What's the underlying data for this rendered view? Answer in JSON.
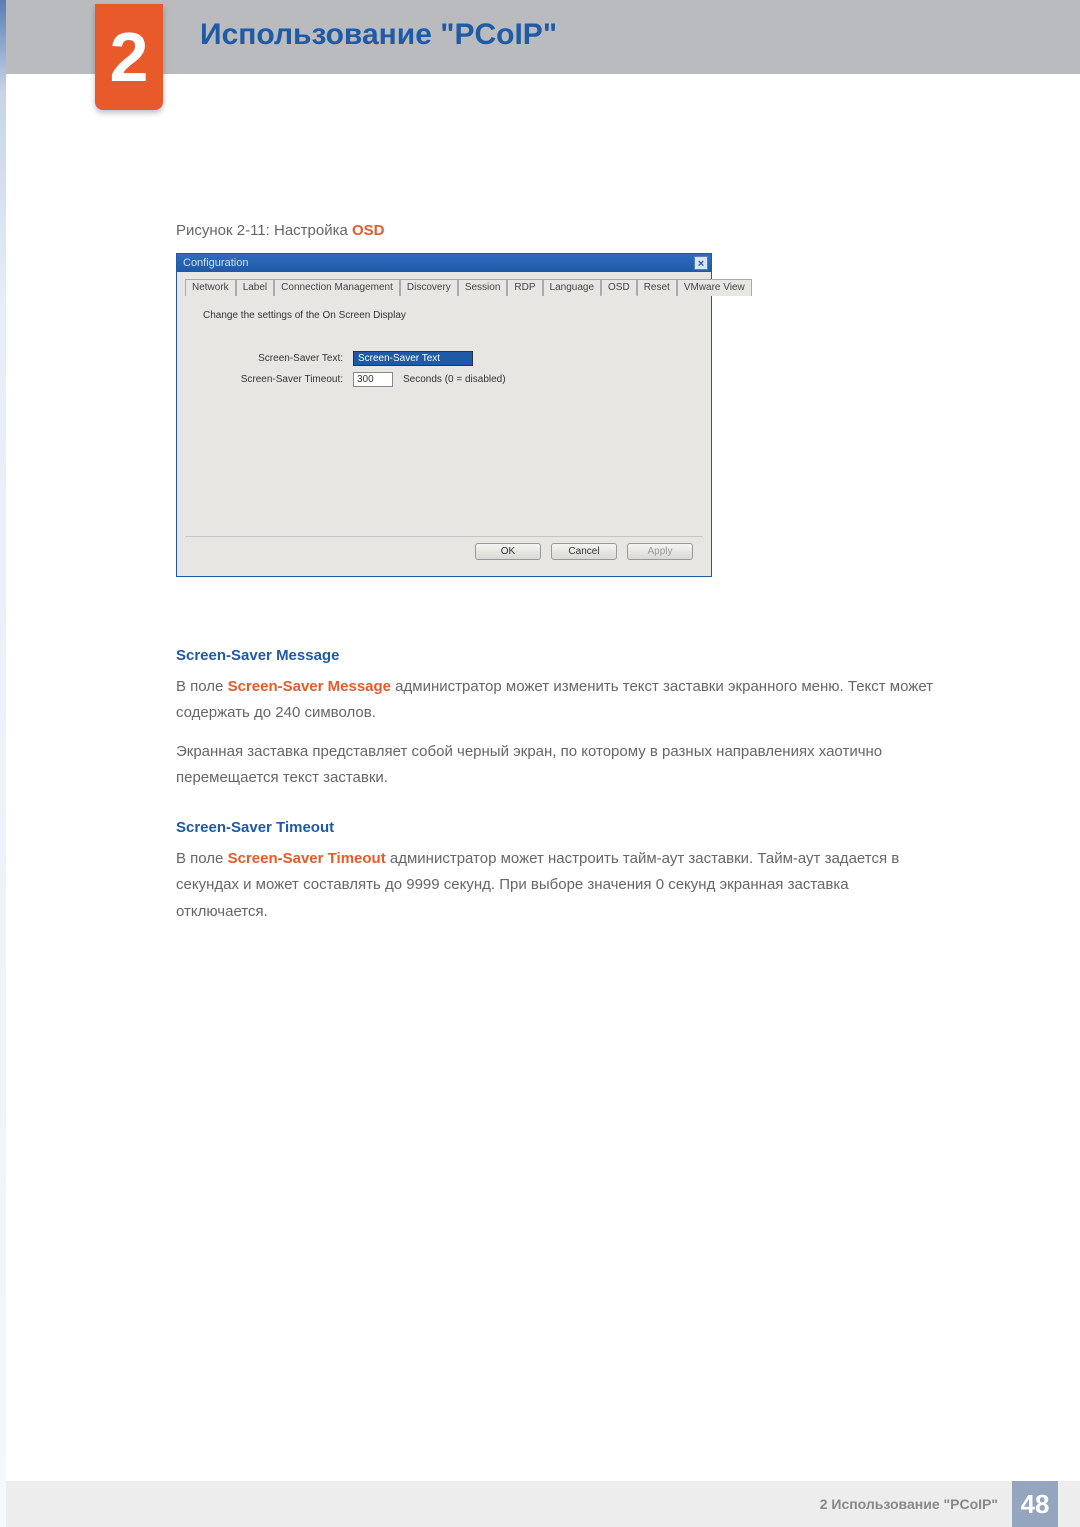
{
  "chapter_number": "2",
  "page_title": "Использование \"PCoIP\"",
  "figure_caption_prefix": "Рисунок 2-11: Настройка ",
  "figure_caption_bold": "OSD",
  "dialog": {
    "title": "Configuration",
    "close_glyph": "×",
    "tabs": [
      "Network",
      "Label",
      "Connection Management",
      "Discovery",
      "Session",
      "RDP",
      "Language",
      "OSD",
      "Reset",
      "VMware View"
    ],
    "active_tab_index": 7,
    "description": "Change the settings of the On Screen Display",
    "field_text_label": "Screen-Saver Text:",
    "field_text_value": "Screen-Saver Text",
    "field_timeout_label": "Screen-Saver Timeout:",
    "field_timeout_value": "300",
    "field_timeout_hint": "Seconds (0 = disabled)",
    "buttons": {
      "ok": "OK",
      "cancel": "Cancel",
      "apply": "Apply"
    }
  },
  "section1_head": "Screen-Saver Message",
  "section1_p1_prefix": "В поле ",
  "section1_p1_bold": "Screen-Saver Message",
  "section1_p1_suffix": " администратор может изменить текст заставки экранного меню. Текст может содержать до 240 символов.",
  "section1_p2": "Экранная заставка представляет собой черный экран, по которому в разных направлениях хаотично перемещается текст заставки.",
  "section2_head": "Screen-Saver Timeout",
  "section2_p1_prefix": "В поле ",
  "section2_p1_bold": "Screen-Saver Timeout",
  "section2_p1_suffix": " администратор может настроить тайм-аут заставки. Тайм-аут задается в секундах и может составлять до 9999 секунд. При выборе значения 0 секунд экранная заставка отключается.",
  "footer_text": "2 Использование \"PCoIP\"",
  "page_number": "48"
}
